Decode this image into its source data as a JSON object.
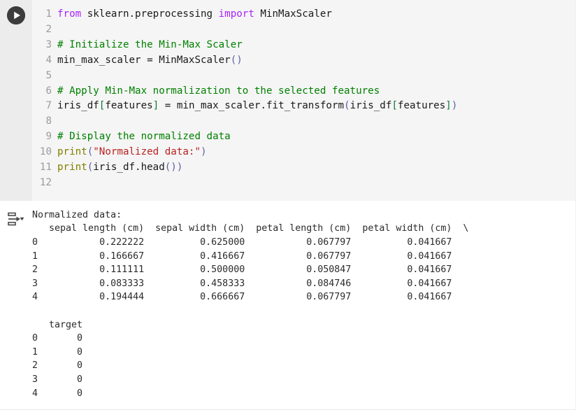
{
  "cell": {
    "run_button_label": "Run cell",
    "run_icon": "play-circle-icon",
    "output_icon": "output-collapse-icon",
    "code_lines": [
      {
        "n": "1",
        "tokens": [
          {
            "t": "kw",
            "s": "from"
          },
          {
            "t": "plain",
            "s": " sklearn.preprocessing "
          },
          {
            "t": "kw",
            "s": "import"
          },
          {
            "t": "plain",
            "s": " MinMaxScaler"
          }
        ]
      },
      {
        "n": "2",
        "tokens": []
      },
      {
        "n": "3",
        "tokens": [
          {
            "t": "comment",
            "s": "# Initialize the Min-Max Scaler"
          }
        ]
      },
      {
        "n": "4",
        "tokens": [
          {
            "t": "plain",
            "s": "min_max_scaler = MinMaxScaler"
          },
          {
            "t": "paren",
            "s": "()"
          }
        ]
      },
      {
        "n": "5",
        "tokens": []
      },
      {
        "n": "6",
        "tokens": [
          {
            "t": "comment",
            "s": "# Apply Min-Max normalization to the selected features"
          }
        ]
      },
      {
        "n": "7",
        "tokens": [
          {
            "t": "plain",
            "s": "iris_df"
          },
          {
            "t": "bracket",
            "s": "["
          },
          {
            "t": "plain",
            "s": "features"
          },
          {
            "t": "bracket",
            "s": "]"
          },
          {
            "t": "plain",
            "s": " = min_max_scaler.fit_transform"
          },
          {
            "t": "paren",
            "s": "("
          },
          {
            "t": "plain",
            "s": "iris_df"
          },
          {
            "t": "bracket",
            "s": "["
          },
          {
            "t": "plain",
            "s": "features"
          },
          {
            "t": "bracket",
            "s": "]"
          },
          {
            "t": "paren",
            "s": ")"
          }
        ]
      },
      {
        "n": "8",
        "tokens": []
      },
      {
        "n": "9",
        "tokens": [
          {
            "t": "comment",
            "s": "# Display the normalized data"
          }
        ]
      },
      {
        "n": "10",
        "tokens": [
          {
            "t": "builtin",
            "s": "print"
          },
          {
            "t": "paren",
            "s": "("
          },
          {
            "t": "string",
            "s": "\"Normalized data:\""
          },
          {
            "t": "paren",
            "s": ")"
          }
        ]
      },
      {
        "n": "11",
        "tokens": [
          {
            "t": "builtin",
            "s": "print"
          },
          {
            "t": "paren",
            "s": "("
          },
          {
            "t": "plain",
            "s": "iris_df.head"
          },
          {
            "t": "paren",
            "s": "()"
          },
          {
            "t": "paren",
            "s": ")"
          }
        ]
      },
      {
        "n": "12",
        "tokens": []
      }
    ],
    "code_plain": "from sklearn.preprocessing import MinMaxScaler\n\n# Initialize the Min-Max Scaler\nmin_max_scaler = MinMaxScaler()\n\n# Apply Min-Max normalization to the selected features\niris_df[features] = min_max_scaler.fit_transform(iris_df[features])\n\n# Display the normalized data\nprint(\"Normalized data:\")\nprint(iris_df.head())\n"
  },
  "output": {
    "heading": "Normalized data:",
    "block1": {
      "header_columns": [
        "sepal length (cm)",
        "sepal width (cm)",
        "petal length (cm)",
        "petal width (cm)"
      ],
      "continuation_marker": "\\",
      "index": [
        "0",
        "1",
        "2",
        "3",
        "4"
      ],
      "rows": [
        [
          "0.222222",
          "0.625000",
          "0.067797",
          "0.041667"
        ],
        [
          "0.166667",
          "0.416667",
          "0.067797",
          "0.041667"
        ],
        [
          "0.111111",
          "0.500000",
          "0.050847",
          "0.041667"
        ],
        [
          "0.083333",
          "0.458333",
          "0.084746",
          "0.041667"
        ],
        [
          "0.194444",
          "0.666667",
          "0.067797",
          "0.041667"
        ]
      ]
    },
    "block2": {
      "header_columns": [
        "target"
      ],
      "index": [
        "0",
        "1",
        "2",
        "3",
        "4"
      ],
      "rows": [
        [
          "0"
        ],
        [
          "0"
        ],
        [
          "0"
        ],
        [
          "0"
        ],
        [
          "0"
        ]
      ]
    },
    "text": "Normalized data:\n   sepal length (cm)  sepal width (cm)  petal length (cm)  petal width (cm)  \\\n0           0.222222          0.625000           0.067797          0.041667   \n1           0.166667          0.416667           0.067797          0.041667   \n2           0.111111          0.500000           0.050847          0.041667   \n3           0.083333          0.458333           0.084746          0.041667   \n4           0.194444          0.666667           0.067797          0.041667   \n\n   target  \n0       0  \n1       0  \n2       0  \n3       0  \n4       0  "
  },
  "colors": {
    "cell_background": "#f5f5f5",
    "gutter_background": "#ececec",
    "output_background": "#ffffff",
    "keyword": "#aa22ff",
    "comment": "#008000",
    "builtin": "#808000",
    "string": "#ba2121",
    "paren": "#5f5fa6",
    "bracket": "#0b7a3b",
    "line_number": "#9a9a9a",
    "text": "#1a1a1a",
    "run_button": "#3c3c3c"
  }
}
